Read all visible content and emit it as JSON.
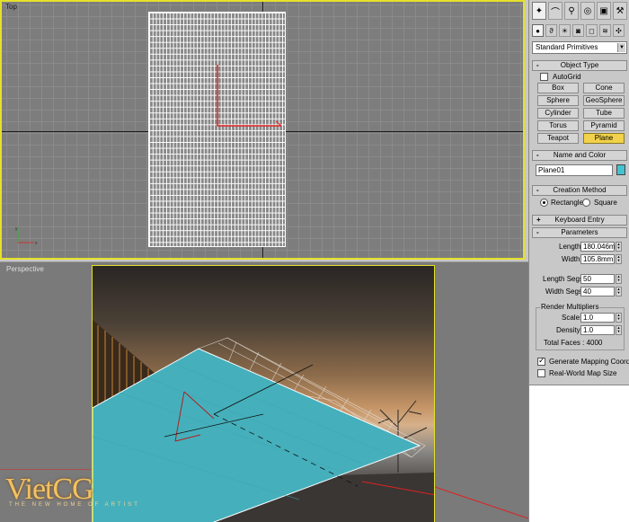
{
  "viewports": {
    "top_label": "Top",
    "perspective_label": "Perspective"
  },
  "logo": {
    "main": "VietCG",
    "tagline": "THE NEW HOME OF ARTIST"
  },
  "panel": {
    "tab_icons": [
      "create-icon",
      "modify-icon",
      "hierarchy-icon",
      "motion-icon",
      "display-icon",
      "utilities-icon"
    ],
    "category_icons": [
      "geometry-icon",
      "shapes-icon",
      "lights-icon",
      "cameras-icon",
      "helpers-icon",
      "spacewarps-icon",
      "systems-icon"
    ],
    "dropdown_value": "Standard Primitives",
    "object_type": {
      "title": "Object Type",
      "autogrid_label": "AutoGrid",
      "buttons": [
        "Box",
        "Cone",
        "Sphere",
        "GeoSphere",
        "Cylinder",
        "Tube",
        "Torus",
        "Pyramid",
        "Teapot",
        "Plane"
      ],
      "active": "Plane"
    },
    "name_color": {
      "title": "Name and Color",
      "name_value": "Plane01",
      "color": "#45c2d0"
    },
    "creation_method": {
      "title": "Creation Method",
      "options": [
        "Rectangle",
        "Square"
      ],
      "selected": "Rectangle"
    },
    "keyboard_entry": {
      "title": "Keyboard Entry"
    },
    "parameters": {
      "title": "Parameters",
      "length_label": "Length:",
      "length_value": "180.046m",
      "width_label": "Width:",
      "width_value": "105.8mm",
      "length_segs_label": "Length Segs:",
      "length_segs_value": "50",
      "width_segs_label": "Width Segs:",
      "width_segs_value": "40",
      "render_multipliers_label": "Render Multipliers",
      "scale_label": "Scale:",
      "scale_value": "1.0",
      "density_label": "Density:",
      "density_value": "1.0",
      "total_faces": "Total Faces : 4000",
      "gen_mapping_label": "Generate Mapping Coords.",
      "real_world_label": "Real-World Map Size"
    }
  },
  "colors": {
    "viewport_active_border": "#e6e12a",
    "plane_color": "#45c2d0",
    "active_button": "#f2d24a"
  }
}
